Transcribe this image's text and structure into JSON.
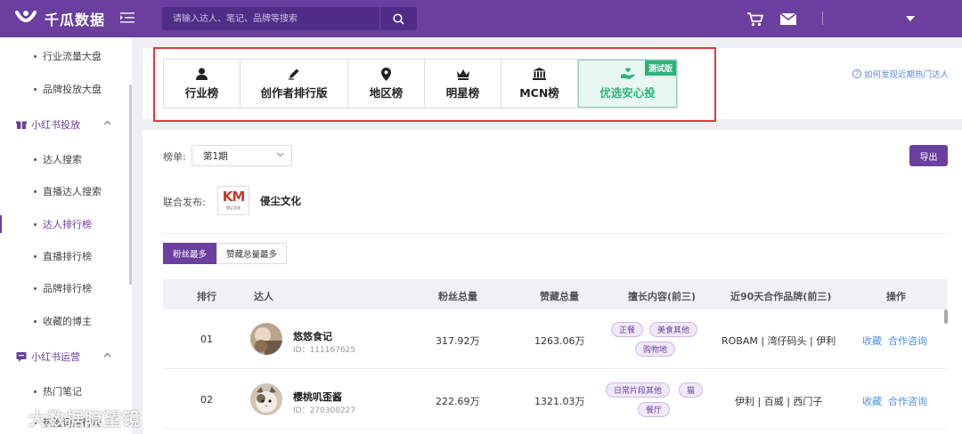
{
  "header": {
    "brand": "千瓜数据",
    "search_placeholder": "请输入达人、笔记、品牌等搜索"
  },
  "sidebar": {
    "items_top": [
      {
        "label": "行业流量大盘"
      },
      {
        "label": "品牌投放大盘"
      }
    ],
    "group1": {
      "label": "小红书投放"
    },
    "group1_items": [
      {
        "label": "达人搜索"
      },
      {
        "label": "直播达人搜索"
      },
      {
        "label": "达人排行榜"
      },
      {
        "label": "直播排行榜"
      },
      {
        "label": "品牌排行榜"
      },
      {
        "label": "收藏的博主"
      }
    ],
    "group2": {
      "label": "小红书运营"
    },
    "group2_items": [
      {
        "label": "热门笔记"
      },
      {
        "label": "热搜词排行榜"
      }
    ]
  },
  "tabs": [
    {
      "label": "行业榜",
      "icon": "person-icon"
    },
    {
      "label": "创作者排行版",
      "icon": "pen-icon"
    },
    {
      "label": "地区榜",
      "icon": "location-pin-icon"
    },
    {
      "label": "明星榜",
      "icon": "crown-icon"
    },
    {
      "label": "MCN榜",
      "icon": "building-icon"
    },
    {
      "label": "优选安心投",
      "icon": "hand-heart-icon",
      "badge": "测试版"
    }
  ],
  "help_link": "如何发现近期热门达人",
  "filters": {
    "list_label": "榜单:",
    "period_value": "第1期",
    "export_label": "导出",
    "co_publish_label": "联合发布:",
    "co_publisher_name": "侵尘文化",
    "co_logo_text": "KM",
    "co_logo_sub": "侵尘文化"
  },
  "sort_tabs": [
    "粉丝最多",
    "赞藏总量最多"
  ],
  "table": {
    "headers": [
      "排行",
      "达人",
      "粉丝总量",
      "赞藏总量",
      "擅长内容(前三)",
      "近90天合作品牌(前三)",
      "操作"
    ],
    "rows": [
      {
        "rank": "01",
        "name": "悠悠食记",
        "id": "ID：111167625",
        "fans": "317.92万",
        "likes": "1263.06万",
        "tags": [
          "正餐",
          "美食其他",
          "购物地"
        ],
        "brands": "ROBAM | 湾仔码头 | 伊利",
        "op1": "收藏",
        "op2": "合作咨询"
      },
      {
        "rank": "02",
        "name": "樱桃叽歪酱",
        "id": "ID：270300227",
        "fans": "222.69万",
        "likes": "1321.03万",
        "tags": [
          "日常片段其他",
          "猫",
          "餐厅"
        ],
        "brands": "伊利 | 百威 | 西门子",
        "op1": "收藏",
        "op2": "合作咨询"
      }
    ]
  },
  "watermark": "大数据瞭望镜",
  "colors": {
    "primary": "#6b3f9e",
    "trial_green": "#2bb37a",
    "link_blue": "#4a90e2",
    "highlight_red": "#e03a3a"
  }
}
